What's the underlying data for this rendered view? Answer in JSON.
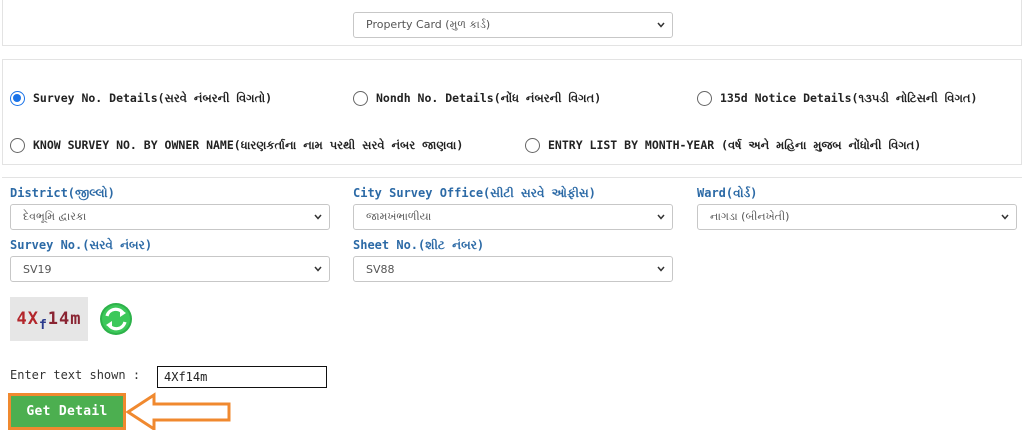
{
  "report_type": {
    "selected": "Property Card (મુળ કાર્ડ)"
  },
  "options": [
    {
      "label": "Survey No. Details(સરવે નંબરની વિગતો)",
      "checked": true
    },
    {
      "label": "Nondh No. Details(નોંધ નંબરની વિગત)",
      "checked": false
    },
    {
      "label": "135d Notice Details(૧૩૫ડી નોટિસની વિગત)",
      "checked": false
    },
    {
      "label": "KNOW SURVEY NO. BY OWNER NAME(ધારણકર્તાના નામ પરથી સરવે નંબર જાણવા)",
      "checked": false
    },
    {
      "label": "ENTRY LIST BY MONTH-YEAR (વર્ષ અને મહિના મુજબ નોંધોની વિગત)",
      "checked": false
    }
  ],
  "form": {
    "district": {
      "label": "District(જીલ્લો)",
      "value": "દેવભૂમિ દ્વારકા"
    },
    "city_survey_office": {
      "label": "City Survey Office(સીટી સરવે ઓફીસ)",
      "value": "જામખંભાળીયા"
    },
    "ward": {
      "label": "Ward(વોર્ડ)",
      "value": "નાગડા (બીનખેતી)"
    },
    "survey_no": {
      "label": "Survey No.(સરવે નંબર)",
      "value": "SV19"
    },
    "sheet_no": {
      "label": "Sheet No.(શીટ નંબર)",
      "value": "SV88"
    }
  },
  "captcha": {
    "part1": "4X",
    "part2": "f",
    "part3": "14m",
    "refresh_icon": "refresh-icon",
    "prompt": "Enter text shown :",
    "value": "4Xf14m"
  },
  "submit": {
    "label": "Get Detail",
    "highlight_color": "#f0892f",
    "button_color": "#4caf50"
  },
  "colors": {
    "field_label": "#2c6aa6",
    "radio_accent": "#1a73e8"
  }
}
